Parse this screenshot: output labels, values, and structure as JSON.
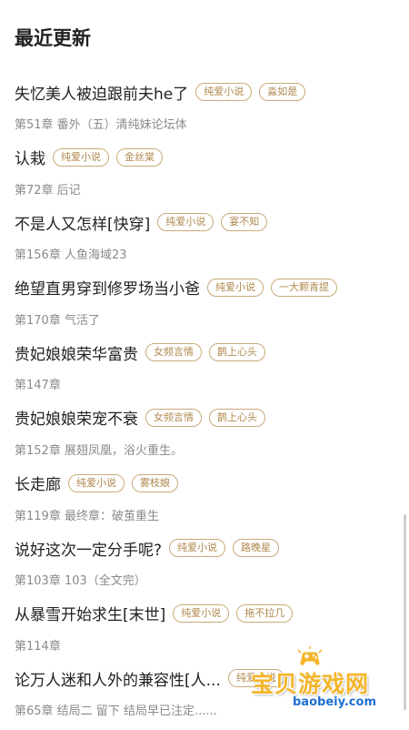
{
  "header": {
    "title": "最近更新"
  },
  "items": [
    {
      "title": "失忆美人被迫跟前夫he了",
      "tags": [
        "纯爱小说",
        "淼如是"
      ],
      "chapter": "第51章 番外（五）清纯妹论坛体"
    },
    {
      "title": "认栽",
      "tags": [
        "纯爱小说",
        "金丝棠"
      ],
      "chapter": "第72章 后记"
    },
    {
      "title": "不是人又怎样[快穿]",
      "tags": [
        "纯爱小说",
        "宴不知"
      ],
      "chapter": "第156章 人鱼海域23"
    },
    {
      "title": "绝望直男穿到修罗场当小爸",
      "tags": [
        "纯爱小说",
        "一大颗青提"
      ],
      "chapter": "第170章 气活了"
    },
    {
      "title": "贵妃娘娘荣华富贵",
      "tags": [
        "女频言情",
        "鹊上心头"
      ],
      "chapter": "第147章"
    },
    {
      "title": "贵妃娘娘荣宠不衰",
      "tags": [
        "女频言情",
        "鹊上心头"
      ],
      "chapter": "第152章 展翅凤凰，浴火重生。"
    },
    {
      "title": "长走廊",
      "tags": [
        "纯爱小说",
        "雾枝娘"
      ],
      "chapter": "第119章 最终章：破茧重生"
    },
    {
      "title": "说好这次一定分手呢?",
      "tags": [
        "纯爱小说",
        "路晚星"
      ],
      "chapter": "第103章 103（全文完）"
    },
    {
      "title": "从暴雪开始求生[末世]",
      "tags": [
        "纯爱小说",
        "拖不拉几"
      ],
      "chapter": "第114章"
    },
    {
      "title": "论万人迷和人外的兼容性[人...",
      "tags": [
        "纯爱小说"
      ],
      "chapter": "第65章 结局二 留下 结局早已注定......"
    }
  ],
  "watermark": {
    "text": "宝贝游戏网",
    "url": "baobeiy.com",
    "icon": "gamepad-icon"
  },
  "colors": {
    "tag_border": "#c9a97b",
    "tag_text": "#b0894f",
    "title": "#222222",
    "chapter": "#8a8a8a"
  }
}
